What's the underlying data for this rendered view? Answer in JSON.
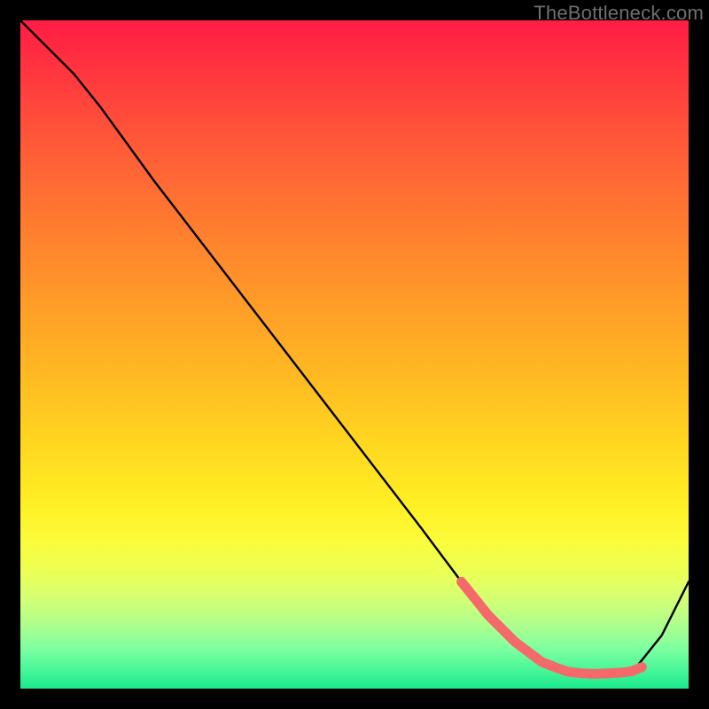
{
  "watermark": "TheBottleneck.com",
  "chart_data": {
    "type": "line",
    "title": "",
    "xlabel": "",
    "ylabel": "",
    "xlim": [
      0,
      100
    ],
    "ylim": [
      0,
      100
    ],
    "series": [
      {
        "name": "curve",
        "x": [
          0,
          4,
          8,
          12,
          20,
          30,
          40,
          50,
          60,
          66,
          70,
          74,
          78,
          82,
          86,
          90,
          92,
          96,
          100
        ],
        "y": [
          100,
          96,
          92,
          87,
          76,
          63,
          50,
          37,
          24,
          16,
          11,
          7,
          4,
          2.5,
          2.2,
          2.4,
          3,
          8,
          16
        ]
      }
    ],
    "highlights": {
      "name": "marker-band",
      "color": "#f46a6a",
      "points_x": [
        66,
        68,
        70,
        72,
        74,
        76,
        78,
        80,
        82,
        84,
        86,
        88,
        90,
        91.5,
        93
      ],
      "points_y": [
        16,
        13.5,
        11,
        9,
        7,
        5.5,
        4,
        3.2,
        2.5,
        2.3,
        2.2,
        2.3,
        2.4,
        2.6,
        3.2
      ]
    }
  }
}
